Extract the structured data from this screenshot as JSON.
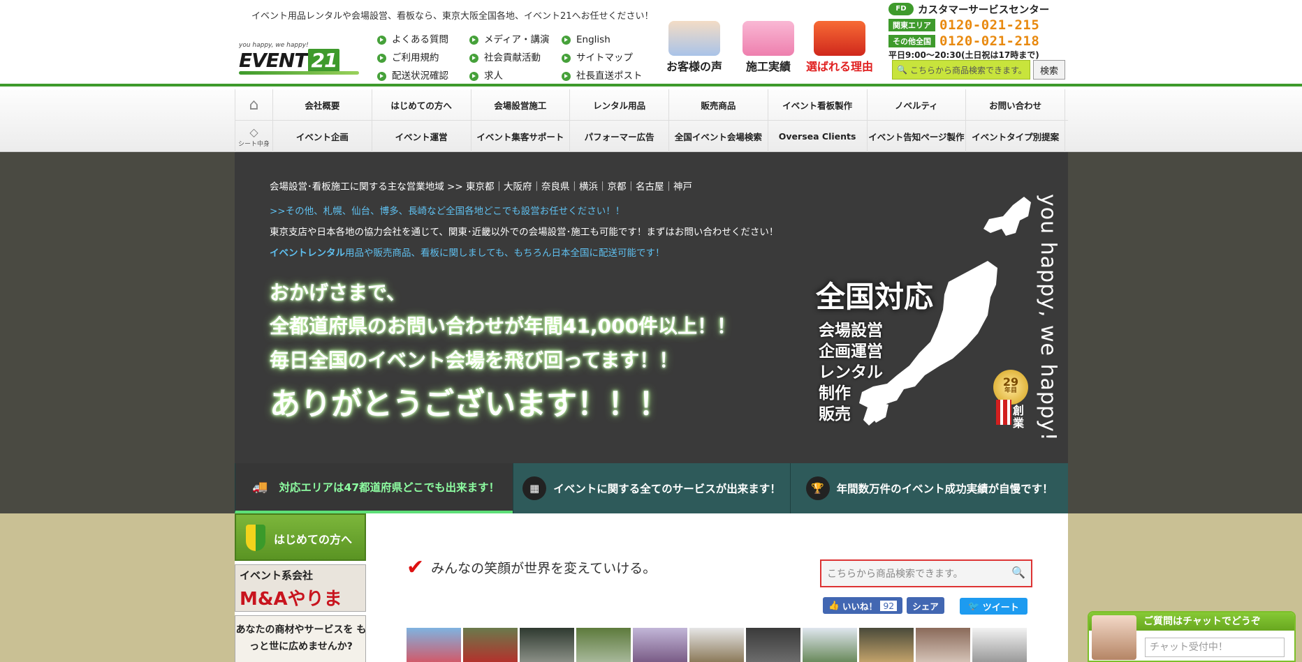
{
  "header": {
    "tagline": "イベント用品レンタルや会場設営、看板なら、東京大阪全国各地、イベント21へお任せください！",
    "logo_small": "you happy, we happy!",
    "logo_big": "EVENT",
    "logo_num": "21",
    "links_col1": [
      "よくある質問",
      "ご利用規約",
      "配送状況確認"
    ],
    "links_col2": [
      "メディア・講演",
      "社会貢献活動",
      "求人"
    ],
    "links_col3": [
      "English",
      "サイトマップ",
      "社長直送ポスト"
    ],
    "promos": [
      {
        "label": "お客様の声",
        "color": "#333333"
      },
      {
        "label": "施工実績",
        "color": "#333333"
      },
      {
        "label": "選ばれる理由",
        "color": "#e02020"
      }
    ],
    "contact": {
      "title": "カスタマーサービスセンター",
      "free_dial": "FD",
      "rows": [
        {
          "tag": "関東エリア",
          "tel": "0120-021-215"
        },
        {
          "tag": "その他全国",
          "tel": "0120-021-218"
        }
      ],
      "hours": "平日9:00〜20:30(土日祝は17時まで)"
    },
    "search": {
      "placeholder": "こちらから商品検索できます。",
      "button": "検索"
    }
  },
  "nav": {
    "row1_side": "",
    "row1": [
      "会社概要",
      "はじめての方へ",
      "会場設営施工",
      "レンタル用品",
      "販売商品",
      "イベント看板製作",
      "ノベルティ",
      "お問い合わせ"
    ],
    "row2_side": "シート中身",
    "row2": [
      "イベント企画",
      "イベント運営",
      "イベント集客サポート",
      "パフォーマー広告",
      "全国イベント会場検索",
      "Oversea Clients",
      "イベント告知ページ製作",
      "イベントタイプ別提案"
    ]
  },
  "hero": {
    "area_line": "会場設営･看板施工に関する主な営業地域 >> 東京都｜大阪府｜奈良県｜横浜｜京都｜名古屋｜神戸",
    "line2": ">>その他、札幌、仙台、博多、長崎など全国各地どこでも設営お任せください！！",
    "line3": "東京支店や日本各地の協力会社を通じて、関東･近畿以外での会場設営･施工も可能です！まずはお問い合わせください！",
    "line4_bold": "イベントレンタル",
    "line4_rest": "用品や販売商品、看板に関しましても、もちろん日本全国に配送可能です！",
    "glow1": "おかげさまで、",
    "glow2": "全都道府県のお問い合わせが年間41,000件以上！！",
    "glow3": "毎日全国のイベント会場を飛び回ってます！！",
    "glow4": "ありがとうございます！！！",
    "zenkoku": "全国対応",
    "services": [
      "会場設営",
      "企画運営",
      "レンタル",
      "制作",
      "販売"
    ],
    "motto": "you happy, we happy!",
    "badge_num": "29",
    "badge_unit": "年目",
    "sou": "創業"
  },
  "tabs": [
    {
      "icon": "truck-icon",
      "glyph": "🚚",
      "label": "対応エリアは47都道府県どこでも出来ます！",
      "active": true
    },
    {
      "icon": "grid-icon",
      "glyph": "▦",
      "label": "イベントに関する全てのサービスが出来ます！",
      "active": false
    },
    {
      "icon": "trophy-icon",
      "glyph": "🏆",
      "label": "年間数万件のイベント成功実績が自慢です！",
      "active": false
    }
  ],
  "content": {
    "banner1": "はじめての方へ",
    "banner2_a": "イベント系会社",
    "banner2_b": "M&Aやります!",
    "banner3": "あなたの商材やサービスを もっと世に広めませんか?",
    "catch": "みんなの笑顔が世界を変えていける。",
    "search_placeholder": "こちらから商品検索できます。",
    "like_label": "いいね！",
    "like_count": "92",
    "share_label": "シェア",
    "tweet_label": "ツイート"
  },
  "chat": {
    "title": "ご質問はチャットでどうぞ",
    "placeholder": "チャット受付中！"
  }
}
